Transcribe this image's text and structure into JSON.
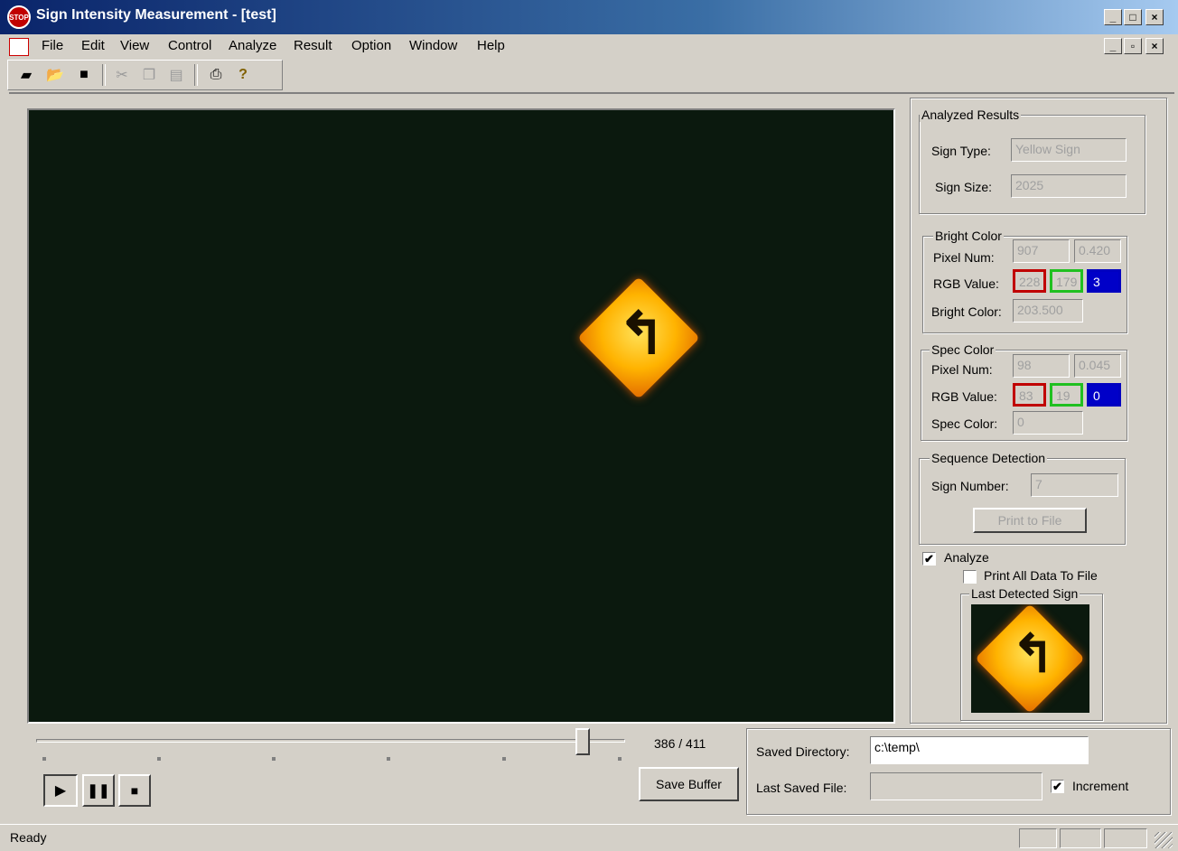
{
  "window": {
    "title": "Sign Intensity Measurement - [test]",
    "app_icon_text": "STOP",
    "caption_buttons": [
      "_",
      "□",
      "×"
    ],
    "mdi_buttons": [
      "_",
      "▫",
      "×"
    ]
  },
  "menu": [
    {
      "label": "File"
    },
    {
      "label": "Edit"
    },
    {
      "label": "View"
    },
    {
      "label": "Control"
    },
    {
      "label": "Analyze"
    },
    {
      "label": "Result"
    },
    {
      "label": "Option"
    },
    {
      "label": "Window"
    },
    {
      "label": "Help"
    }
  ],
  "toolbar": [
    {
      "icon": "camera-icon",
      "glyph": "▰",
      "enabled": true
    },
    {
      "icon": "open-folder-icon",
      "glyph": "📂",
      "enabled": true
    },
    {
      "icon": "save-icon",
      "glyph": "■",
      "enabled": true
    },
    {
      "icon": "cut-icon",
      "glyph": "✂",
      "enabled": false
    },
    {
      "icon": "copy-icon",
      "glyph": "❐",
      "enabled": false
    },
    {
      "icon": "paste-icon",
      "glyph": "▤",
      "enabled": false
    },
    {
      "icon": "print-icon",
      "glyph": "⎙",
      "enabled": true
    },
    {
      "icon": "help-icon",
      "glyph": "?",
      "enabled": true
    }
  ],
  "results": {
    "group_label": "Analyzed Results",
    "sign_type_label": "Sign Type:",
    "sign_type_value": "Yellow Sign",
    "sign_size_label": "Sign Size:",
    "sign_size_value": "2025"
  },
  "bright": {
    "group_label": "Bright Color",
    "pixel_num_label": "Pixel Num:",
    "pixel_num": "907",
    "pixel_ratio": "0.420",
    "rgb_label": "RGB Value:",
    "r": "228",
    "g": "179",
    "b": "3",
    "color_label": "Bright Color:",
    "color_value": "203.500"
  },
  "spec": {
    "group_label": "Spec Color",
    "pixel_num_label": "Pixel Num:",
    "pixel_num": "98",
    "pixel_ratio": "0.045",
    "rgb_label": "RGB Value:",
    "r": "83",
    "g": "19",
    "b": "0",
    "color_label": "Spec Color:",
    "color_value": "0"
  },
  "sequence": {
    "group_label": "Sequence Detection",
    "sign_number_label": "Sign Number:",
    "sign_number": "7",
    "print_button": "Print to File"
  },
  "analyze_checkbox": {
    "label": "Analyze",
    "checked": true
  },
  "print_all_checkbox": {
    "label": "Print All Data To File",
    "checked": false
  },
  "last_sign_label": "Last Detected Sign",
  "playback": {
    "frame_readout": "386 / 411",
    "position_fraction": 0.939,
    "save_buffer": "Save Buffer",
    "controls": [
      "play-icon",
      "pause-icon",
      "stop-icon"
    ]
  },
  "save": {
    "dir_label": "Saved Directory:",
    "dir_value": "c:\\temp\\",
    "last_label": "Last Saved File:",
    "last_value": "",
    "increment_label": "Increment",
    "increment_checked": true
  },
  "status": {
    "text": "Ready"
  }
}
